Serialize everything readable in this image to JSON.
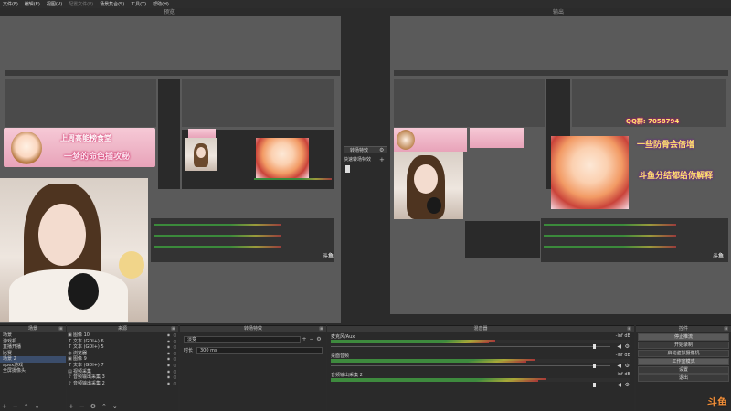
{
  "menu": {
    "items": [
      {
        "label": "文件(F)",
        "enabled": true
      },
      {
        "label": "编辑(E)",
        "enabled": true
      },
      {
        "label": "视图(V)",
        "enabled": true
      },
      {
        "label": "配置文件(P)",
        "enabled": false
      },
      {
        "label": "场景集合(S)",
        "enabled": true
      },
      {
        "label": "工具(T)",
        "enabled": true
      },
      {
        "label": "帮助(H)",
        "enabled": true
      }
    ]
  },
  "preview": {
    "label": "预览"
  },
  "program": {
    "label": "输出"
  },
  "transition_controls": {
    "transition_label": "转场特效",
    "quick_label": "快速转场特效"
  },
  "stream_overlay": {
    "banner_main": "上周高能榜食堂",
    "banner_sub": "一梦的命色插攻秘",
    "id_line": "QQ群: 7058794",
    "line_a": "一些防骨会倍增",
    "line_b": "斗鱼分结都给你解释"
  },
  "watermark": "斗鱼",
  "scenes": {
    "title": "场景",
    "items": [
      {
        "name": "场景",
        "selected": false
      },
      {
        "name": "游戏机",
        "selected": false
      },
      {
        "name": "直播开播",
        "selected": false
      },
      {
        "name": "比赛",
        "selected": false
      },
      {
        "name": "场景 2",
        "selected": true
      },
      {
        "name": "apex游戏",
        "selected": false
      },
      {
        "name": "全屏摄像头",
        "selected": false
      }
    ]
  },
  "sources": {
    "title": "来源",
    "items": [
      {
        "icon": "image-icon",
        "glyph": "▣",
        "name": "图像 10"
      },
      {
        "icon": "text-icon",
        "glyph": "T",
        "name": "文本 (GDI+) 6"
      },
      {
        "icon": "text-icon",
        "glyph": "T",
        "name": "文本 (GDI+) 5"
      },
      {
        "icon": "browser-icon",
        "glyph": "◍",
        "name": "浏览器"
      },
      {
        "icon": "image-icon",
        "glyph": "▣",
        "name": "图像 9"
      },
      {
        "icon": "text-icon",
        "glyph": "T",
        "name": "文本 (GDI+) 7"
      },
      {
        "icon": "capture-icon",
        "glyph": "▤",
        "name": "视频采集"
      },
      {
        "icon": "audio-icon",
        "glyph": "♪",
        "name": "音频输出采集 3"
      },
      {
        "icon": "audio-icon",
        "glyph": "♪",
        "name": "音频输出采集 2"
      }
    ]
  },
  "transitions": {
    "title": "转场特效",
    "selected": "淡变",
    "duration_label": "时长",
    "duration_value": "300 ms"
  },
  "mixer": {
    "title": "混音器",
    "channels": [
      {
        "name": "麦克风/Aux",
        "db": "-inf dB",
        "level": 0.55,
        "volume": 0.96
      },
      {
        "name": "桌面音频",
        "db": "-inf dB",
        "level": 0.68,
        "volume": 0.96
      },
      {
        "name": "音频输出采集 2",
        "db": "-inf dB",
        "level": 0.72,
        "volume": 0.96
      }
    ]
  },
  "controls": {
    "title": "控件",
    "buttons": [
      {
        "label": "停止推流",
        "active": true
      },
      {
        "label": "开始录制",
        "active": false
      },
      {
        "label": "启动虚拟摄像机",
        "active": false
      },
      {
        "label": "工作室模式",
        "active": true
      },
      {
        "label": "设置",
        "active": false
      },
      {
        "label": "退出",
        "active": false
      }
    ]
  },
  "colors": {
    "accent": "#3b4d6b",
    "meter_green": "#3e8a3e",
    "watermark": "#f08f3b"
  }
}
